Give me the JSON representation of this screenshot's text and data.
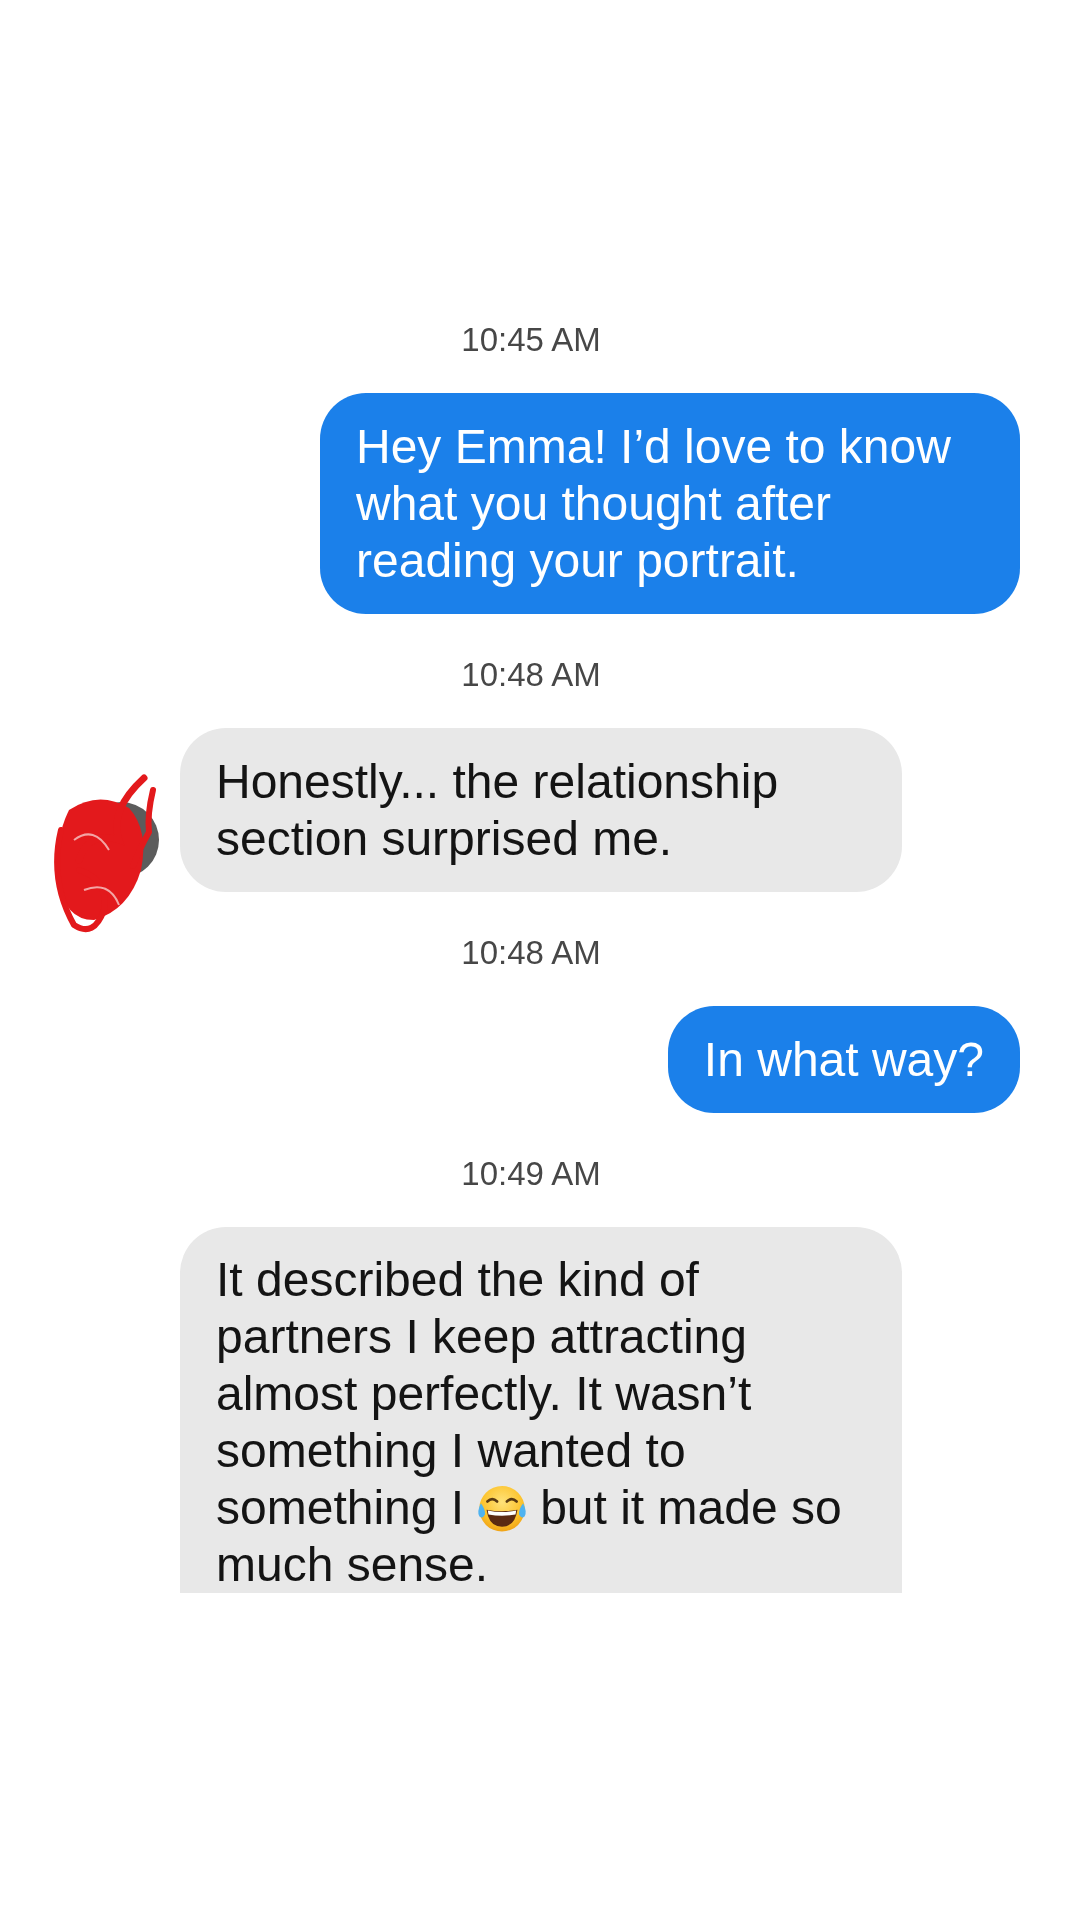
{
  "conversation": [
    {
      "kind": "timestamp",
      "text": "10:45 AM"
    },
    {
      "kind": "outgoing",
      "clipped": false,
      "segments": [
        {
          "kind": "text",
          "text": "Hey Emma! I’d love to know what you thought after reading your portrait."
        }
      ]
    },
    {
      "kind": "timestamp",
      "text": "10:48 AM"
    },
    {
      "kind": "incoming",
      "avatar_scribbled": true,
      "clipped": false,
      "segments": [
        {
          "kind": "text",
          "text": "Honestly... the relationship section surprised me."
        }
      ]
    },
    {
      "kind": "timestamp",
      "text": "10:48 AM"
    },
    {
      "kind": "outgoing",
      "clipped": false,
      "segments": [
        {
          "kind": "text",
          "text": "In what way?"
        }
      ]
    },
    {
      "kind": "timestamp",
      "text": "10:49 AM"
    },
    {
      "kind": "incoming",
      "avatar_scribbled": false,
      "clipped": true,
      "segments": [
        {
          "kind": "text",
          "text": "It described the kind of partners I keep attracting almost perfectly. It wasn’t something I wanted to something I"
        },
        {
          "kind": "emoji"
        },
        {
          "kind": "text",
          "text": "but it made so much sense."
        }
      ]
    }
  ]
}
